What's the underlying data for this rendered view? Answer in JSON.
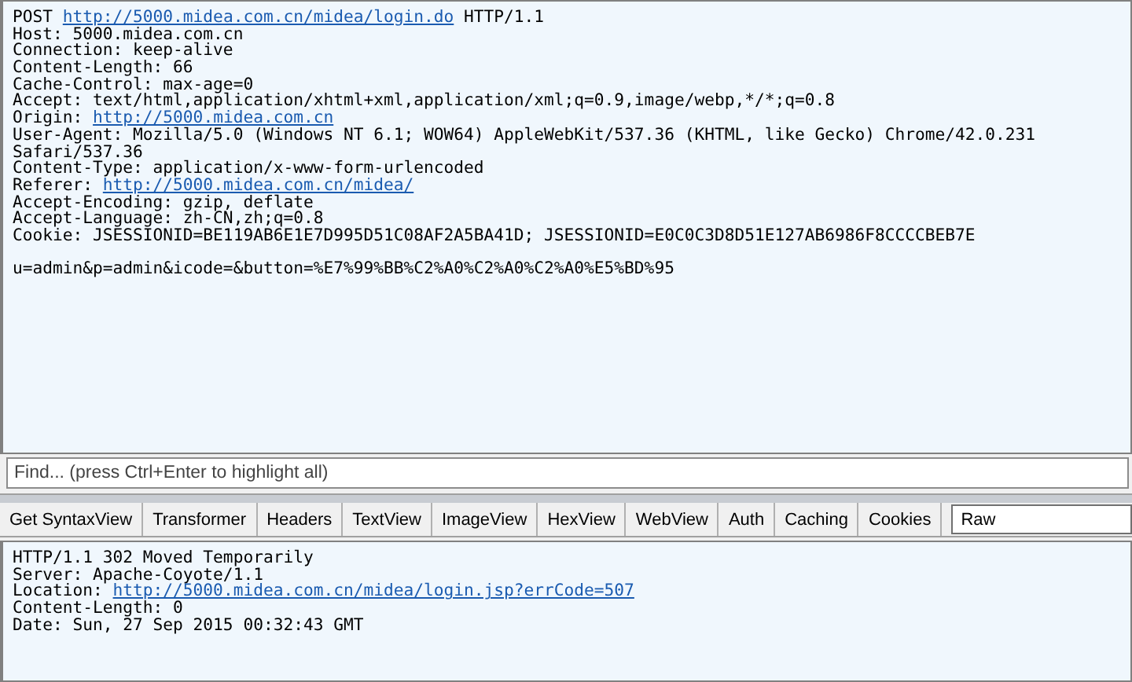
{
  "request": {
    "lines": [
      [
        {
          "kind": "text",
          "text": "POST "
        },
        {
          "kind": "link",
          "text": "http://5000.midea.com.cn/midea/login.do"
        },
        {
          "kind": "text",
          "text": " HTTP/1.1"
        }
      ],
      [
        {
          "kind": "text",
          "text": "Host: 5000.midea.com.cn"
        }
      ],
      [
        {
          "kind": "text",
          "text": "Connection: keep-alive"
        }
      ],
      [
        {
          "kind": "text",
          "text": "Content-Length: 66"
        }
      ],
      [
        {
          "kind": "text",
          "text": "Cache-Control: max-age=0"
        }
      ],
      [
        {
          "kind": "text",
          "text": "Accept: text/html,application/xhtml+xml,application/xml;q=0.9,image/webp,*/*;q=0.8"
        }
      ],
      [
        {
          "kind": "text",
          "text": "Origin: "
        },
        {
          "kind": "link",
          "text": "http://5000.midea.com.cn"
        }
      ],
      [
        {
          "kind": "text",
          "text": "User-Agent: Mozilla/5.0 (Windows NT 6.1; WOW64) AppleWebKit/537.36 (KHTML, like Gecko) Chrome/42.0.231"
        }
      ],
      [
        {
          "kind": "text",
          "text": "Safari/537.36"
        }
      ],
      [
        {
          "kind": "text",
          "text": "Content-Type: application/x-www-form-urlencoded"
        }
      ],
      [
        {
          "kind": "text",
          "text": "Referer: "
        },
        {
          "kind": "link",
          "text": "http://5000.midea.com.cn/midea/"
        }
      ],
      [
        {
          "kind": "text",
          "text": "Accept-Encoding: gzip, deflate"
        }
      ],
      [
        {
          "kind": "text",
          "text": "Accept-Language: zh-CN,zh;q=0.8"
        }
      ],
      [
        {
          "kind": "text",
          "text": "Cookie: JSESSIONID=BE119AB6E1E7D995D51C08AF2A5BA41D; JSESSIONID=E0C0C3D8D51E127AB6986F8CCCCBEB7E"
        }
      ],
      [
        {
          "kind": "blank"
        }
      ],
      [
        {
          "kind": "text",
          "text": "u=admin&p=admin&icode=&button=%E7%99%BB%C2%A0%C2%A0%C2%A0%E5%BD%95"
        }
      ]
    ]
  },
  "find": {
    "placeholder": "Find... (press Ctrl+Enter to highlight all)"
  },
  "tabs": [
    {
      "label": "Get SyntaxView",
      "selected": false
    },
    {
      "label": "Transformer",
      "selected": false
    },
    {
      "label": "Headers",
      "selected": false
    },
    {
      "label": "TextView",
      "selected": false
    },
    {
      "label": "ImageView",
      "selected": false
    },
    {
      "label": "HexView",
      "selected": false
    },
    {
      "label": "WebView",
      "selected": false
    },
    {
      "label": "Auth",
      "selected": false
    },
    {
      "label": "Caching",
      "selected": false
    },
    {
      "label": "Cookies",
      "selected": false
    },
    {
      "label": "Raw",
      "selected": true
    }
  ],
  "response": {
    "lines": [
      [
        {
          "kind": "text",
          "text": "HTTP/1.1 302 Moved Temporarily"
        }
      ],
      [
        {
          "kind": "text",
          "text": "Server: Apache-Coyote/1.1"
        }
      ],
      [
        {
          "kind": "text",
          "text": "Location: "
        },
        {
          "kind": "link",
          "text": "http://5000.midea.com.cn/midea/login.jsp?errCode=507"
        }
      ],
      [
        {
          "kind": "text",
          "text": "Content-Length: 0"
        }
      ],
      [
        {
          "kind": "text",
          "text": "Date: Sun, 27 Sep 2015 00:32:43 GMT"
        }
      ]
    ]
  }
}
